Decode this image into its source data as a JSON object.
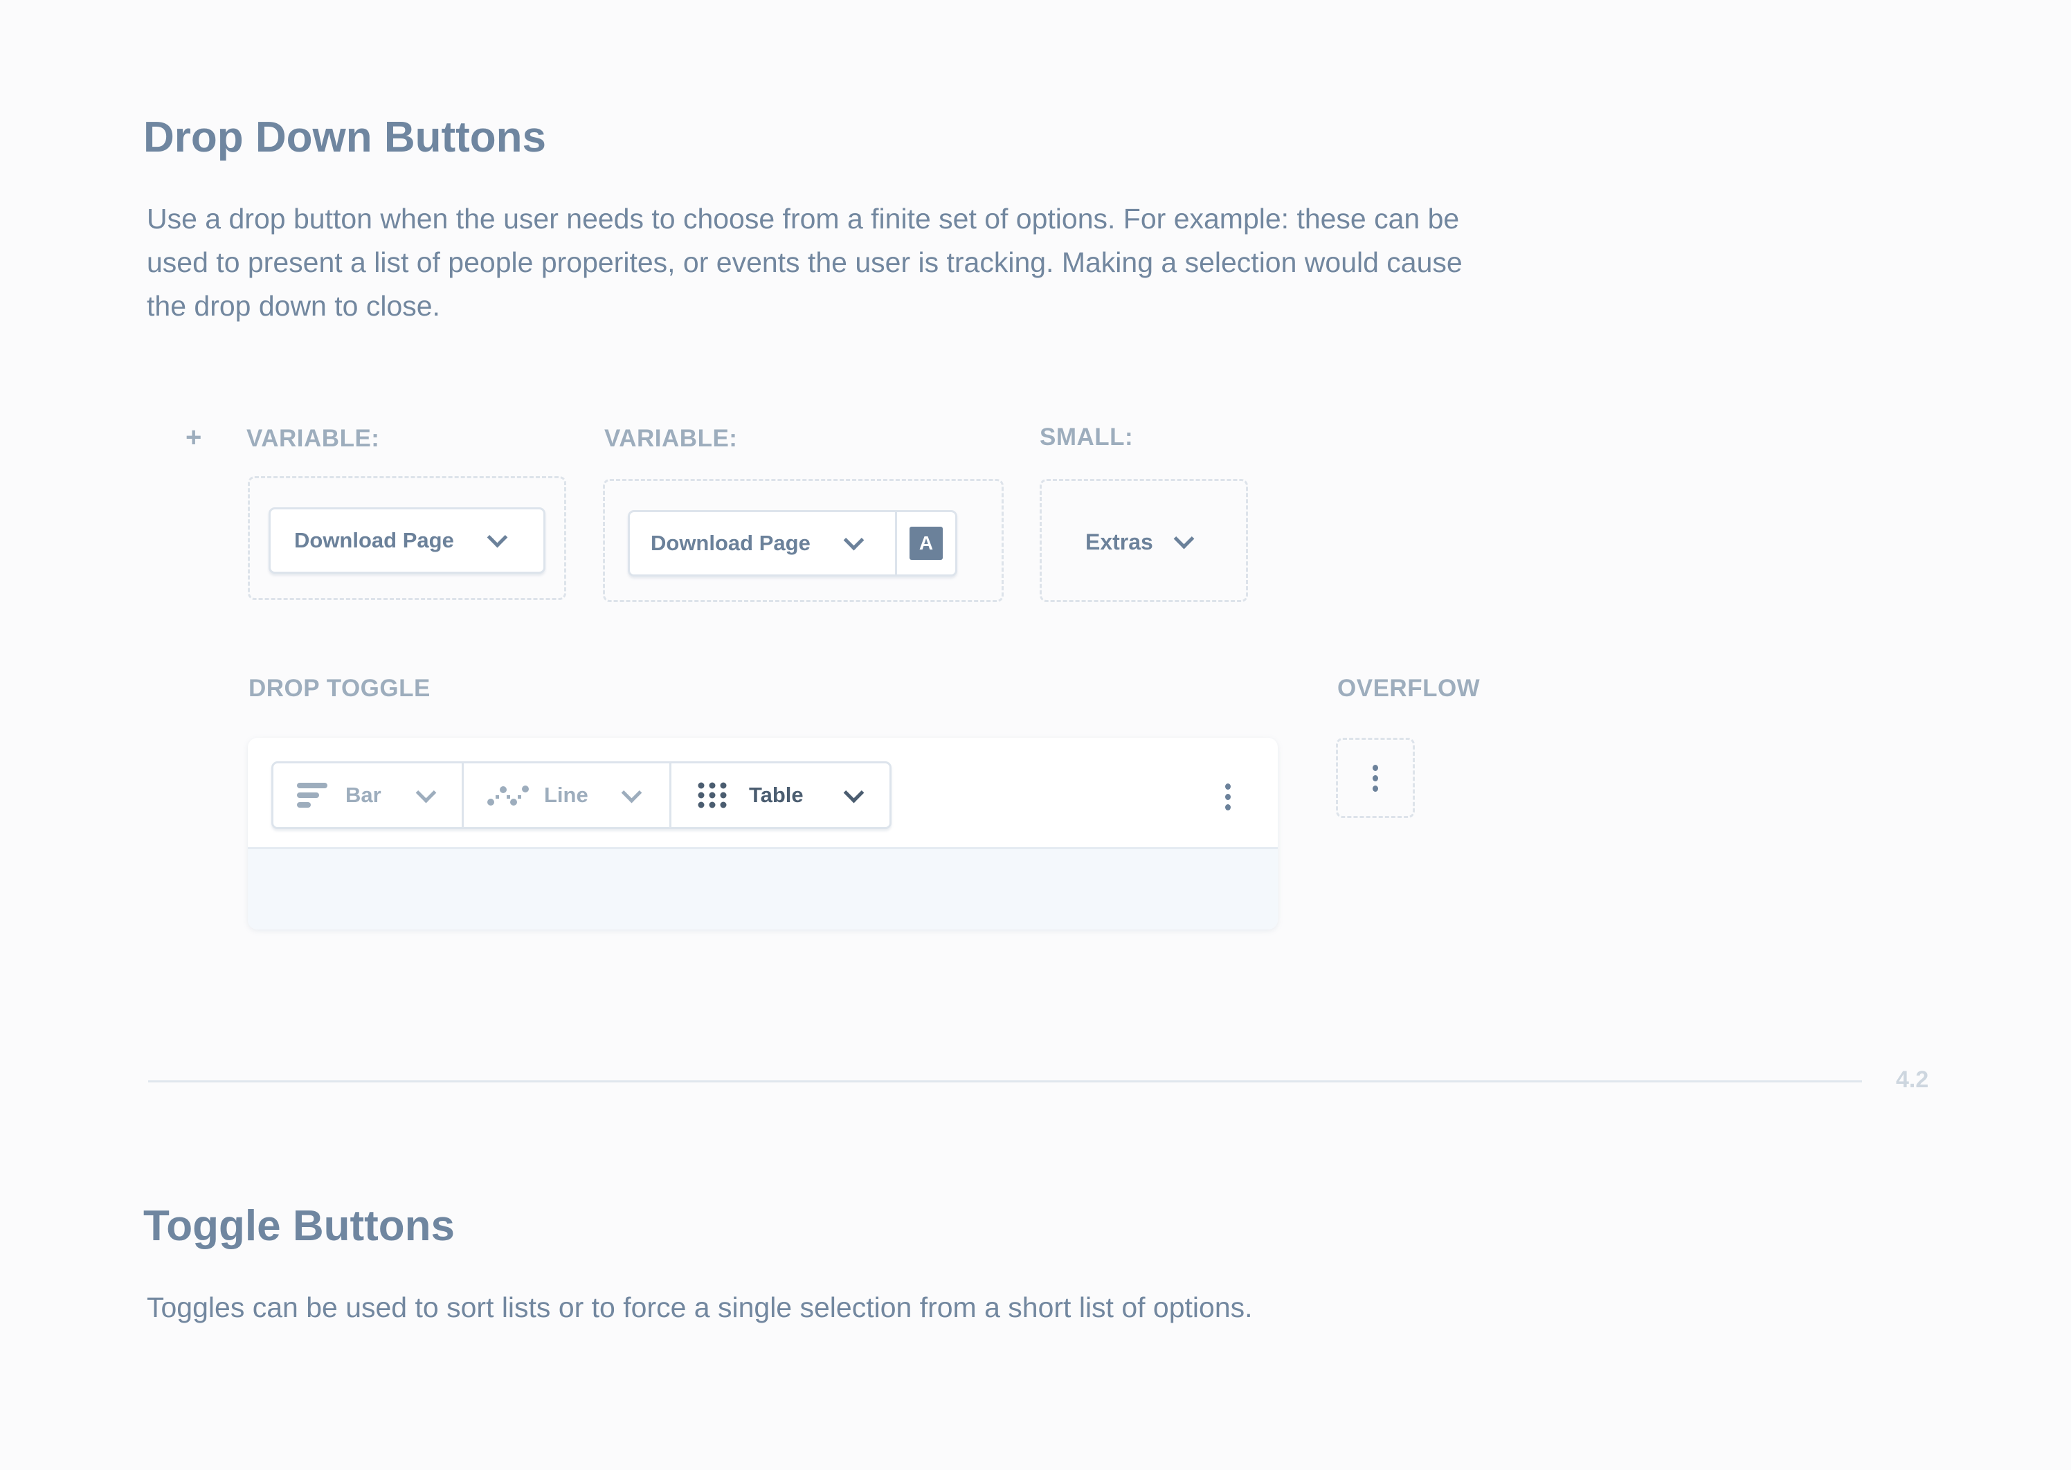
{
  "section1": {
    "title": "Drop Down Buttons",
    "description_lines": [
      "Use a drop button when the user needs to choose from a finite set of options. For example: these can be",
      "used to present a list of people properites, or events the user is tracking. Making a selection would cause",
      "the drop down to close."
    ],
    "add_icon": "+",
    "examples": [
      {
        "label": "VARIABLE:",
        "button_label": "Download Page",
        "icon": "chevron-down-icon"
      },
      {
        "label": "VARIABLE:",
        "button_label": "Download Page",
        "icon": "chevron-down-icon",
        "addon_badge": "A"
      },
      {
        "label": "SMALL:",
        "button_label": "Extras",
        "icon": "chevron-down-icon"
      }
    ],
    "drop_toggle": {
      "label": "DROP TOGGLE",
      "items": [
        {
          "label": "Bar",
          "icon": "bar-chart-icon",
          "active": false
        },
        {
          "label": "Line",
          "icon": "line-chart-icon",
          "active": false
        },
        {
          "label": "Table",
          "icon": "table-grid-icon",
          "active": true
        }
      ],
      "more_icon": "kebab-menu-icon"
    },
    "overflow": {
      "label": "OVERFLOW",
      "icon": "kebab-menu-icon"
    }
  },
  "divider": {
    "page_number": "4.2"
  },
  "section2": {
    "title": "Toggle Buttons",
    "description": "Toggles can be used to sort lists or to force a single selection from a short list of options."
  },
  "colors": {
    "heading": "#6f86a0",
    "label": "#9dadbd",
    "button_text": "#6b819a",
    "active_text": "#4b5d70",
    "badge_bg": "#6b819a",
    "dashed_border": "#dde3ea",
    "background": "#fbfbfc"
  }
}
